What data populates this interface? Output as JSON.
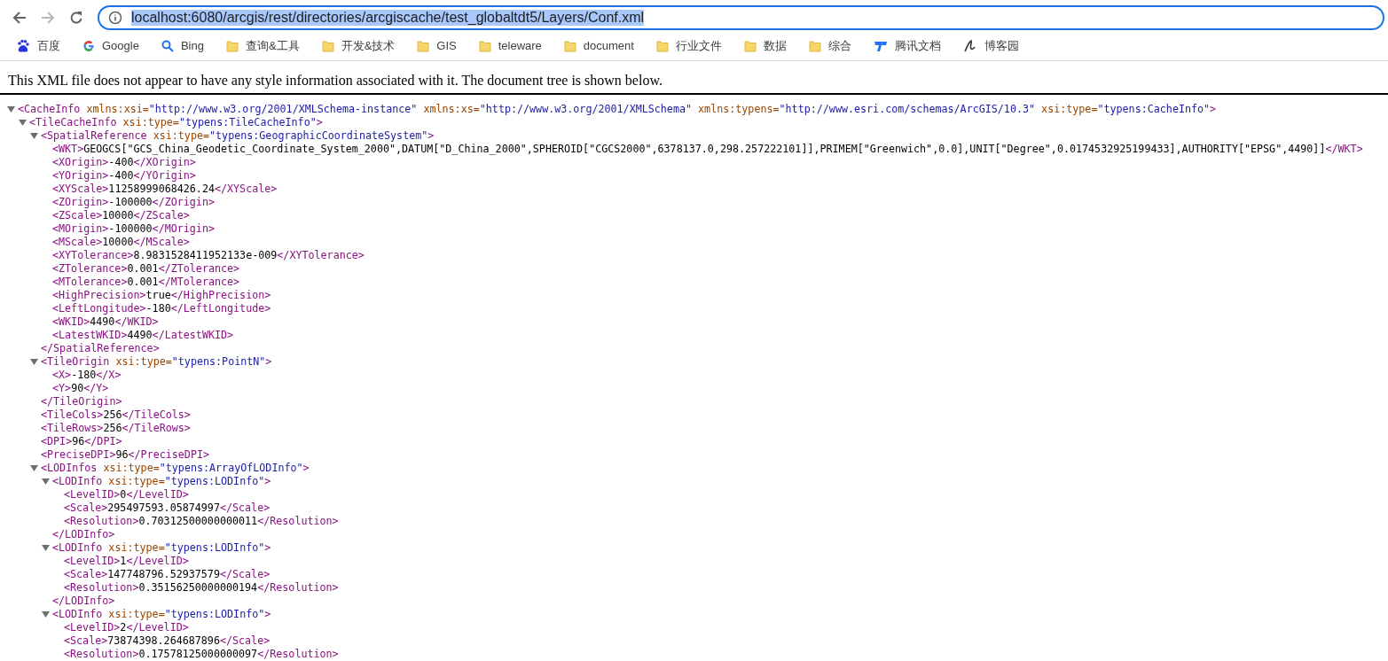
{
  "nav_buttons": [
    {
      "kind": "back",
      "disabled": false
    },
    {
      "kind": "forward",
      "disabled": true
    },
    {
      "kind": "reload",
      "disabled": false
    }
  ],
  "address_bar": {
    "url": "localhost:6080/arcgis/rest/directories/arcgiscache/test_globaltdt5/Layers/Conf.xml",
    "selected": true
  },
  "bookmarks": [
    {
      "kind": "baidu",
      "label": "百度"
    },
    {
      "kind": "google",
      "label": "Google"
    },
    {
      "kind": "bing",
      "label": "Bing"
    },
    {
      "kind": "folder",
      "label": "查询&工具"
    },
    {
      "kind": "folder",
      "label": "开发&技术"
    },
    {
      "kind": "folder",
      "label": "GIS"
    },
    {
      "kind": "folder",
      "label": "teleware"
    },
    {
      "kind": "folder",
      "label": "document"
    },
    {
      "kind": "folder",
      "label": "行业文件"
    },
    {
      "kind": "folder",
      "label": "数据"
    },
    {
      "kind": "folder",
      "label": "综合"
    },
    {
      "kind": "docs",
      "label": "腾讯文档"
    },
    {
      "kind": "blog",
      "label": "博客园"
    }
  ],
  "notice": "This XML file does not appear to have any style information associated with it. The document tree is shown below.",
  "xml_tree": {
    "open": "<CacheInfo",
    "attributes": [
      {
        "name": "xmlns:xsi=",
        "value": "\"http://www.w3.org/2001/XMLSchema-instance\""
      },
      {
        "name": "xmlns:xs=",
        "value": "\"http://www.w3.org/2001/XMLSchema\""
      },
      {
        "name": "xmlns:typens=",
        "value": "\"http://www.esri.com/schemas/ArcGIS/10.3\""
      },
      {
        "name": "xsi:type=",
        "value": "\"typens:CacheInfo\""
      }
    ],
    "open_end": ">",
    "expanded": true,
    "children": [
      {
        "open": "<TileCacheInfo",
        "attributes": [
          {
            "name": "xsi:type=",
            "value": "\"typens:TileCacheInfo\""
          }
        ],
        "open_end": ">",
        "expanded": true,
        "children": [
          {
            "open": "<SpatialReference",
            "attributes": [
              {
                "name": "xsi:type=",
                "value": "\"typens:GeographicCoordinateSystem\""
              }
            ],
            "open_end": ">",
            "expanded": true,
            "close": "</SpatialReference>",
            "children": [
              {
                "open": "<WKT>",
                "text": "GEOGCS[\"GCS_China_Geodetic_Coordinate_System_2000\",DATUM[\"D_China_2000\",SPHEROID[\"CGCS2000\",6378137.0,298.257222101]],PRIMEM[\"Greenwich\",0.0],UNIT[\"Degree\",0.0174532925199433],AUTHORITY[\"EPSG\",4490]]",
                "close": "</WKT>"
              },
              {
                "open": "<XOrigin>",
                "text": "-400",
                "close": "</XOrigin>"
              },
              {
                "open": "<YOrigin>",
                "text": "-400",
                "close": "</YOrigin>"
              },
              {
                "open": "<XYScale>",
                "text": "11258999068426.24",
                "close": "</XYScale>"
              },
              {
                "open": "<ZOrigin>",
                "text": "-100000",
                "close": "</ZOrigin>"
              },
              {
                "open": "<ZScale>",
                "text": "10000",
                "close": "</ZScale>"
              },
              {
                "open": "<MOrigin>",
                "text": "-100000",
                "close": "</MOrigin>"
              },
              {
                "open": "<MScale>",
                "text": "10000",
                "close": "</MScale>"
              },
              {
                "open": "<XYTolerance>",
                "text": "8.9831528411952133e-009",
                "close": "</XYTolerance>"
              },
              {
                "open": "<ZTolerance>",
                "text": "0.001",
                "close": "</ZTolerance>"
              },
              {
                "open": "<MTolerance>",
                "text": "0.001",
                "close": "</MTolerance>"
              },
              {
                "open": "<HighPrecision>",
                "text": "true",
                "close": "</HighPrecision>"
              },
              {
                "open": "<LeftLongitude>",
                "text": "-180",
                "close": "</LeftLongitude>"
              },
              {
                "open": "<WKID>",
                "text": "4490",
                "close": "</WKID>"
              },
              {
                "open": "<LatestWKID>",
                "text": "4490",
                "close": "</LatestWKID>"
              }
            ]
          },
          {
            "open": "<TileOrigin",
            "attributes": [
              {
                "name": "xsi:type=",
                "value": "\"typens:PointN\""
              }
            ],
            "open_end": ">",
            "expanded": true,
            "close": "</TileOrigin>",
            "children": [
              {
                "open": "<X>",
                "text": "-180",
                "close": "</X>"
              },
              {
                "open": "<Y>",
                "text": "90",
                "close": "</Y>"
              }
            ]
          },
          {
            "open": "<TileCols>",
            "text": "256",
            "close": "</TileCols>"
          },
          {
            "open": "<TileRows>",
            "text": "256",
            "close": "</TileRows>"
          },
          {
            "open": "<DPI>",
            "text": "96",
            "close": "</DPI>"
          },
          {
            "open": "<PreciseDPI>",
            "text": "96",
            "close": "</PreciseDPI>"
          },
          {
            "open": "<LODInfos",
            "attributes": [
              {
                "name": "xsi:type=",
                "value": "\"typens:ArrayOfLODInfo\""
              }
            ],
            "open_end": ">",
            "expanded": true,
            "children": [
              {
                "open": "<LODInfo",
                "attributes": [
                  {
                    "name": "xsi:type=",
                    "value": "\"typens:LODInfo\""
                  }
                ],
                "open_end": ">",
                "expanded": true,
                "close": "</LODInfo>",
                "children": [
                  {
                    "open": "<LevelID>",
                    "text": "0",
                    "close": "</LevelID>"
                  },
                  {
                    "open": "<Scale>",
                    "text": "295497593.05874997",
                    "close": "</Scale>"
                  },
                  {
                    "open": "<Resolution>",
                    "text": "0.70312500000000011",
                    "close": "</Resolution>"
                  }
                ]
              },
              {
                "open": "<LODInfo",
                "attributes": [
                  {
                    "name": "xsi:type=",
                    "value": "\"typens:LODInfo\""
                  }
                ],
                "open_end": ">",
                "expanded": true,
                "close": "</LODInfo>",
                "children": [
                  {
                    "open": "<LevelID>",
                    "text": "1",
                    "close": "</LevelID>"
                  },
                  {
                    "open": "<Scale>",
                    "text": "147748796.52937579",
                    "close": "</Scale>"
                  },
                  {
                    "open": "<Resolution>",
                    "text": "0.35156250000000194",
                    "close": "</Resolution>"
                  }
                ]
              },
              {
                "open": "<LODInfo",
                "attributes": [
                  {
                    "name": "xsi:type=",
                    "value": "\"typens:LODInfo\""
                  }
                ],
                "open_end": ">",
                "expanded": true,
                "children": [
                  {
                    "open": "<LevelID>",
                    "text": "2",
                    "close": "</LevelID>"
                  },
                  {
                    "open": "<Scale>",
                    "text": "73874398.264687896",
                    "close": "</Scale>"
                  },
                  {
                    "open": "<Resolution>",
                    "text": "0.17578125000000097",
                    "close": "</Resolution>"
                  }
                ]
              }
            ]
          }
        ]
      }
    ]
  }
}
